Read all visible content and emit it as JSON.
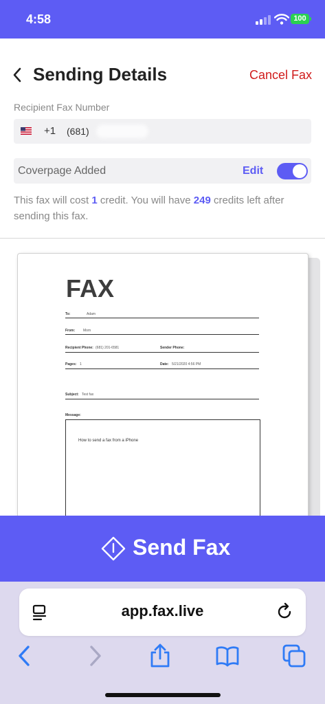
{
  "status": {
    "time": "4:58",
    "battery": "100"
  },
  "header": {
    "title": "Sending Details",
    "cancel": "Cancel Fax"
  },
  "recipient": {
    "label": "Recipient Fax Number",
    "country_code": "+1",
    "number": "(681)"
  },
  "coverpage": {
    "label": "Coverpage Added",
    "edit": "Edit",
    "enabled": true
  },
  "cost": {
    "t1": "This fax will cost ",
    "credit": "1",
    "t2": " credit. You will have ",
    "left": "249",
    "t3": " credits left after sending this fax."
  },
  "preview": {
    "heading": "FAX",
    "to_label": "To:",
    "to": "Adam",
    "from_label": "From:",
    "from": "Mom",
    "rphone_label": "Recipient Phone:",
    "rphone": "(681) 201-6581",
    "sphone_label": "Sender Phone:",
    "pages_label": "Pages:",
    "pages": "1",
    "date_label": "Date:",
    "date": "5/21/2020 4:56 PM",
    "subject_label": "Subject:",
    "subject": "Test fax",
    "message_label": "Message:",
    "message": "How to send a fax from a iPhone"
  },
  "send": {
    "label": "Send Fax"
  },
  "browser": {
    "url": "app.fax.live"
  },
  "colors": {
    "accent": "#5d5cf4",
    "danger": "#d01b1b"
  }
}
